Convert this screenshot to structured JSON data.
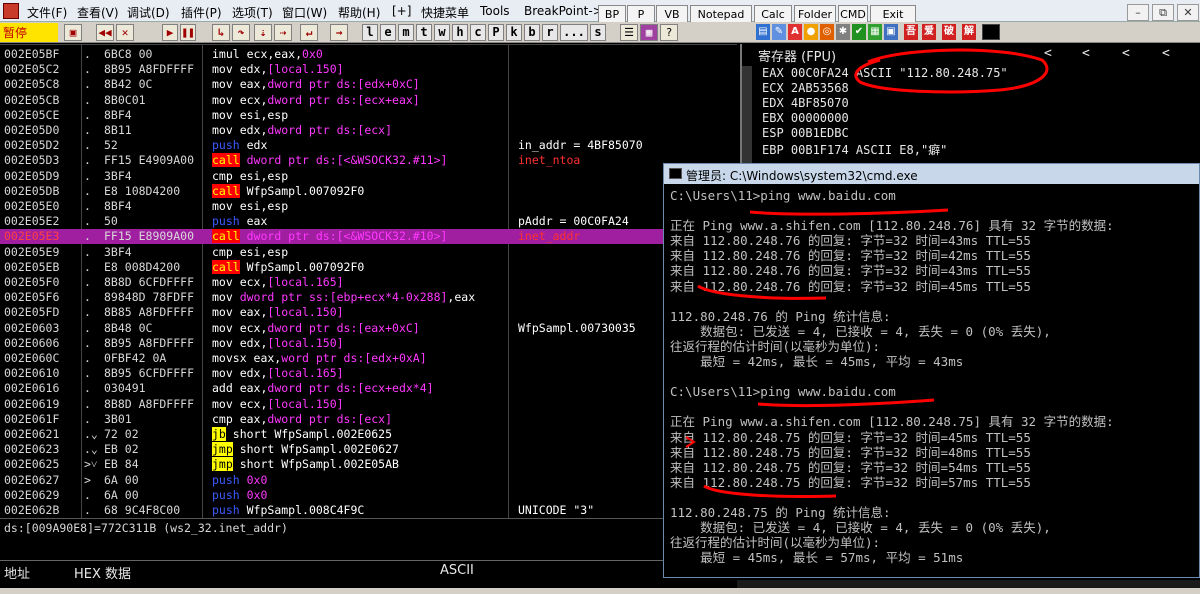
{
  "menubar": {
    "items": [
      "文件(F)",
      "查看(V)",
      "调试(D)",
      "插件(P)",
      "选项(T)",
      "窗口(W)",
      "帮助(H)",
      "[+]",
      "快捷菜单",
      "Tools",
      "BreakPoint->"
    ],
    "plugin_buttons": [
      "BP",
      "P",
      "VB",
      "Notepad",
      "Calc",
      "Folder",
      "CMD",
      "Exit"
    ],
    "window_buttons": [
      "x",
      "⧉",
      "x"
    ]
  },
  "toolbar": {
    "status": "暂停",
    "letters": [
      "l",
      "e",
      "m",
      "t",
      "w",
      "h",
      "c",
      "P",
      "k",
      "b",
      "r",
      "...",
      "s"
    ],
    "plugin_icons": [
      "A",
      "吾",
      "爱",
      "破",
      "解"
    ]
  },
  "cpu": {
    "rows": [
      {
        "addr": "002E05BF",
        "mk": ".",
        "hex": "6BC8 00",
        "dis": [
          {
            "t": "imul ecx,eax,",
            "c": "plain"
          },
          {
            "t": "0x0",
            "c": "ops"
          }
        ],
        "cmt": ""
      },
      {
        "addr": "002E05C2",
        "mk": ".",
        "hex": "8B95 A8FDFFFF",
        "dis": [
          {
            "t": "mov edx,",
            "c": "plain"
          },
          {
            "t": "[local.150]",
            "c": "ops"
          }
        ],
        "cmt": ""
      },
      {
        "addr": "002E05C8",
        "mk": ".",
        "hex": "8B42 0C",
        "dis": [
          {
            "t": "mov eax,",
            "c": "plain"
          },
          {
            "t": "dword ptr ds:[edx+0xC]",
            "c": "ops"
          }
        ],
        "cmt": ""
      },
      {
        "addr": "002E05CB",
        "mk": ".",
        "hex": "8B0C01",
        "dis": [
          {
            "t": "mov ecx,",
            "c": "plain"
          },
          {
            "t": "dword ptr ds:[ecx+eax]",
            "c": "ops"
          }
        ],
        "cmt": ""
      },
      {
        "addr": "002E05CE",
        "mk": ".",
        "hex": "8BF4",
        "dis": [
          {
            "t": "mov esi,esp",
            "c": "plain"
          }
        ],
        "cmt": ""
      },
      {
        "addr": "002E05D0",
        "mk": ".",
        "hex": "8B11",
        "dis": [
          {
            "t": "mov edx,",
            "c": "plain"
          },
          {
            "t": "dword ptr ds:[ecx]",
            "c": "ops"
          }
        ],
        "cmt": ""
      },
      {
        "addr": "002E05D2",
        "mk": ".",
        "hex": "52",
        "dis": [
          {
            "t": "push",
            "c": "kw-push"
          },
          {
            "t": " edx",
            "c": "plain"
          }
        ],
        "cmt": "in_addr = 4BF85070",
        "cc": "plain"
      },
      {
        "addr": "002E05D3",
        "mk": ".",
        "hex": "FF15 E4909A00",
        "dis": [
          {
            "t": "call",
            "c": "kw-call"
          },
          {
            "t": " dword ptr ds:[<&WSOCK32.#11>]",
            "c": "ops"
          }
        ],
        "cmt": "inet_ntoa",
        "cc": "cmt-red"
      },
      {
        "addr": "002E05D9",
        "mk": ".",
        "hex": "3BF4",
        "dis": [
          {
            "t": "cmp esi,esp",
            "c": "plain"
          }
        ],
        "cmt": ""
      },
      {
        "addr": "002E05DB",
        "mk": ".",
        "hex": "E8 108D4200",
        "dis": [
          {
            "t": "call",
            "c": "kw-call"
          },
          {
            "t": " WfpSampl.007092F0",
            "c": "plain"
          }
        ],
        "cmt": ""
      },
      {
        "addr": "002E05E0",
        "mk": ".",
        "hex": "8BF4",
        "dis": [
          {
            "t": "mov esi,esp",
            "c": "plain"
          }
        ],
        "cmt": ""
      },
      {
        "addr": "002E05E2",
        "mk": ".",
        "hex": "50",
        "dis": [
          {
            "t": "push",
            "c": "kw-push"
          },
          {
            "t": " eax",
            "c": "plain"
          }
        ],
        "cmt": "pAddr = 00C0FA24",
        "cc": "plain"
      },
      {
        "addr": "002E05E3",
        "mk": ".",
        "hex": "FF15 E8909A00",
        "dis": [
          {
            "t": "call",
            "c": "kw-call"
          },
          {
            "t": " dword ptr ds:[<&WSOCK32.#10>]",
            "c": "ops"
          }
        ],
        "cmt": "inet_addr",
        "cc": "cmt-red",
        "sel": true
      },
      {
        "addr": "002E05E9",
        "mk": ".",
        "hex": "3BF4",
        "dis": [
          {
            "t": "cmp esi,esp",
            "c": "plain"
          }
        ],
        "cmt": ""
      },
      {
        "addr": "002E05EB",
        "mk": ".",
        "hex": "E8 008D4200",
        "dis": [
          {
            "t": "call",
            "c": "kw-call"
          },
          {
            "t": " WfpSampl.007092F0",
            "c": "plain"
          }
        ],
        "cmt": ""
      },
      {
        "addr": "002E05F0",
        "mk": ".",
        "hex": "8B8D 6CFDFFFF",
        "dis": [
          {
            "t": "mov ecx,",
            "c": "plain"
          },
          {
            "t": "[local.165]",
            "c": "ops"
          }
        ],
        "cmt": ""
      },
      {
        "addr": "002E05F6",
        "mk": ".",
        "hex": "89848D 78FDFF",
        "dis": [
          {
            "t": "mov ",
            "c": "plain"
          },
          {
            "t": "dword ptr ss:[ebp+ecx*4-0x288]",
            "c": "ops"
          },
          {
            "t": ",eax",
            "c": "plain"
          }
        ],
        "cmt": ""
      },
      {
        "addr": "002E05FD",
        "mk": ".",
        "hex": "8B85 A8FDFFFF",
        "dis": [
          {
            "t": "mov eax,",
            "c": "plain"
          },
          {
            "t": "[local.150]",
            "c": "ops"
          }
        ],
        "cmt": ""
      },
      {
        "addr": "002E0603",
        "mk": ".",
        "hex": "8B48 0C",
        "dis": [
          {
            "t": "mov ecx,",
            "c": "plain"
          },
          {
            "t": "dword ptr ds:[eax+0xC]",
            "c": "ops"
          }
        ],
        "cmt": "WfpSampl.00730035",
        "cc": "plain"
      },
      {
        "addr": "002E0606",
        "mk": ".",
        "hex": "8B95 A8FDFFFF",
        "dis": [
          {
            "t": "mov edx,",
            "c": "plain"
          },
          {
            "t": "[local.150]",
            "c": "ops"
          }
        ],
        "cmt": ""
      },
      {
        "addr": "002E060C",
        "mk": ".",
        "hex": "0FBF42 0A",
        "dis": [
          {
            "t": "movsx eax,",
            "c": "plain"
          },
          {
            "t": "word ptr ds:[edx+0xA]",
            "c": "ops"
          }
        ],
        "cmt": ""
      },
      {
        "addr": "002E0610",
        "mk": ".",
        "hex": "8B95 6CFDFFFF",
        "dis": [
          {
            "t": "mov edx,",
            "c": "plain"
          },
          {
            "t": "[local.165]",
            "c": "ops"
          }
        ],
        "cmt": ""
      },
      {
        "addr": "002E0616",
        "mk": ".",
        "hex": "030491",
        "dis": [
          {
            "t": "add eax,",
            "c": "plain"
          },
          {
            "t": "dword ptr ds:[ecx+edx*4]",
            "c": "ops"
          }
        ],
        "cmt": ""
      },
      {
        "addr": "002E0619",
        "mk": ".",
        "hex": "8B8D A8FDFFFF",
        "dis": [
          {
            "t": "mov ecx,",
            "c": "plain"
          },
          {
            "t": "[local.150]",
            "c": "ops"
          }
        ],
        "cmt": ""
      },
      {
        "addr": "002E061F",
        "mk": ".",
        "hex": "3B01",
        "dis": [
          {
            "t": "cmp eax,",
            "c": "plain"
          },
          {
            "t": "dword ptr ds:[ecx]",
            "c": "ops"
          }
        ],
        "cmt": ""
      },
      {
        "addr": "002E0621",
        "mk": ".⌄",
        "hex": "72 02",
        "dis": [
          {
            "t": "jb",
            "c": "kw-jb"
          },
          {
            "t": " short WfpSampl.002E0625",
            "c": "plain"
          }
        ],
        "cmt": ""
      },
      {
        "addr": "002E0623",
        "mk": ".⌄",
        "hex": "EB 02",
        "dis": [
          {
            "t": "jmp",
            "c": "kw-jmp"
          },
          {
            "t": " short WfpSampl.002E0627",
            "c": "plain"
          }
        ],
        "cmt": ""
      },
      {
        "addr": "002E0625",
        "mk": ">˅",
        "hex": "EB 84",
        "dis": [
          {
            "t": "jmp",
            "c": "kw-jmp"
          },
          {
            "t": " short WfpSampl.002E05AB",
            "c": "plain"
          }
        ],
        "cmt": ""
      },
      {
        "addr": "002E0627",
        "mk": ">",
        "hex": "6A 00",
        "dis": [
          {
            "t": "push",
            "c": "kw-push"
          },
          {
            "t": " 0x0",
            "c": "ops"
          }
        ],
        "cmt": ""
      },
      {
        "addr": "002E0629",
        "mk": ".",
        "hex": "6A 00",
        "dis": [
          {
            "t": "push",
            "c": "kw-push"
          },
          {
            "t": " 0x0",
            "c": "ops"
          }
        ],
        "cmt": ""
      },
      {
        "addr": "002E062B",
        "mk": ".",
        "hex": "68 9C4F8C00",
        "dis": [
          {
            "t": "push",
            "c": "kw-push"
          },
          {
            "t": " WfpSampl.008C4F9C",
            "c": "plain"
          }
        ],
        "cmt": "UNICODE \"3\"",
        "cc": "plain"
      }
    ],
    "info_line": "ds:[009A90E8]=772C311B (ws2_32.inet_addr)"
  },
  "dump": {
    "col_addr": "地址",
    "col_hex": "HEX 数据",
    "col_ascii": "ASCII"
  },
  "registers": {
    "title": "寄存器 (FPU)",
    "arrows": [
      "<",
      "<",
      "<",
      "<"
    ],
    "rows": [
      "EAX 00C0FA24 ASCII \"112.80.248.75\"",
      "ECX 2AB53568",
      "EDX 4BF85070",
      "EBX 00000000",
      "ESP 00B1EDBC",
      "EBP 00B1F174 ASCII E8,\"癖\""
    ]
  },
  "cmd": {
    "title": "管理员: C:\\Windows\\system32\\cmd.exe",
    "lines": [
      "C:\\Users\\11>ping www.baidu.com",
      "",
      "正在 Ping www.a.shifen.com [112.80.248.76] 具有 32 字节的数据:",
      "来自 112.80.248.76 的回复: 字节=32 时间=43ms TTL=55",
      "来自 112.80.248.76 的回复: 字节=32 时间=42ms TTL=55",
      "来自 112.80.248.76 的回复: 字节=32 时间=43ms TTL=55",
      "来自 112.80.248.76 的回复: 字节=32 时间=45ms TTL=55",
      "",
      "112.80.248.76 的 Ping 统计信息:",
      "    数据包: 已发送 = 4, 已接收 = 4, 丢失 = 0 (0% 丢失),",
      "往返行程的估计时间(以毫秒为单位):",
      "    最短 = 42ms, 最长 = 45ms, 平均 = 43ms",
      "",
      "C:\\Users\\11>ping www.baidu.com",
      "",
      "正在 Ping www.a.shifen.com [112.80.248.75] 具有 32 字节的数据:",
      "来自 112.80.248.75 的回复: 字节=32 时间=45ms TTL=55",
      "来自 112.80.248.75 的回复: 字节=32 时间=48ms TTL=55",
      "来自 112.80.248.75 的回复: 字节=32 时间=54ms TTL=55",
      "来自 112.80.248.75 的回复: 字节=32 时间=57ms TTL=55",
      "",
      "112.80.248.75 的 Ping 统计信息:",
      "    数据包: 已发送 = 4, 已接收 = 4, 丢失 = 0 (0% 丢失),",
      "往返行程的估计时间(以毫秒为单位):",
      "    最短 = 45ms, 最长 = 57ms, 平均 = 51ms"
    ]
  },
  "colors": {
    "selected_row": "#a01fa0",
    "call_bg": "#ff0000",
    "annotation": "#ff0000",
    "status_bg": "#ffe400"
  }
}
